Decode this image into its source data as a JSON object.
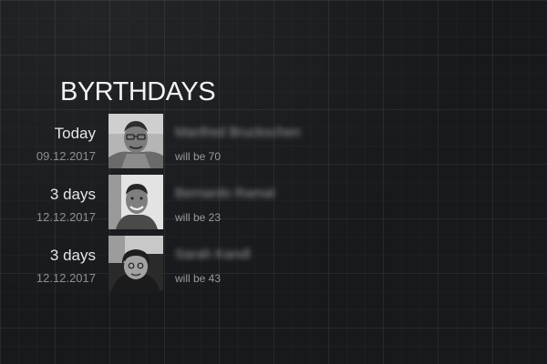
{
  "widget": {
    "title": "BYRTHDAYS",
    "entries": [
      {
        "when": "Today",
        "date": "09.12.2017",
        "name": "Manfred Bruckschen",
        "age_text": "will be 70"
      },
      {
        "when": "3 days",
        "date": "12.12.2017",
        "name": "Bernardo Ramal",
        "age_text": "will be 23"
      },
      {
        "when": "3 days",
        "date": "12.12.2017",
        "name": "Sarah Kandl",
        "age_text": "will be 43"
      }
    ]
  }
}
